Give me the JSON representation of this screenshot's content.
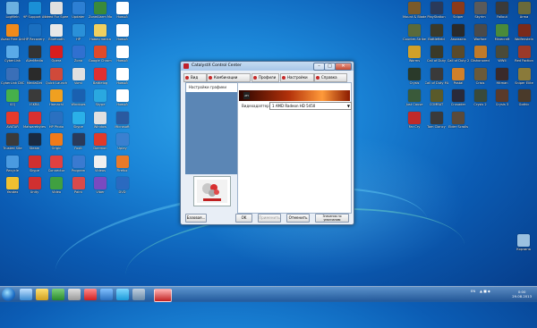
{
  "window": {
    "title": "CatalystX Control Center",
    "menus": [
      "Вид",
      "Комбинации клавиш",
      "Профили",
      "Настройки",
      "Справка"
    ],
    "left_tab": "Настройки графики",
    "right_label": "Видеоадаптер:",
    "adapter_value": "1 AMD Radeon HD 5450",
    "banner_badge": "ATI",
    "thumb_caption": "CATALYST",
    "buttons": {
      "basic": "Базовая...",
      "ok": "OK",
      "apply": "Применить",
      "cancel": "Отменить",
      "defaults": "Значения по умолчанию"
    },
    "controls": {
      "min": "–",
      "max": "□",
      "close": "✕"
    }
  },
  "desktop": {
    "left_icons": [
      {
        "label": "LogMeIn",
        "color": "#6bb0e0"
      },
      {
        "label": "HP Support Assistant",
        "color": "#1a8fd6"
      },
      {
        "label": "Need For Speed World",
        "color": "#e0e0e0"
      },
      {
        "label": "Updater",
        "color": "#2d7fd3"
      },
      {
        "label": "ZoneAlarm Mobile",
        "color": "#3a8a3a"
      },
      {
        "label": "Новый",
        "color": "#ffffff"
      },
      {
        "label": "Avast Free Antivirus",
        "color": "#f08a1a"
      },
      {
        "label": "HP Recovery",
        "color": "#1a6fc0"
      },
      {
        "label": "Bluetooth",
        "color": "#e8e8e8"
      },
      {
        "label": "HP",
        "color": "#2a90d8"
      },
      {
        "label": "Новая папка",
        "color": "#f0d060"
      },
      {
        "label": "Новый",
        "color": "#ffffff"
      },
      {
        "label": "CyberLink",
        "color": "#5aaae8"
      },
      {
        "label": "AVerMedia",
        "color": "#333333"
      },
      {
        "label": "Opera",
        "color": "#d81e1e"
      },
      {
        "label": "Zona",
        "color": "#3070d0"
      },
      {
        "label": "Google Chrome",
        "color": "#e04a2a"
      },
      {
        "label": "Новый",
        "color": "#ffffff"
      },
      {
        "label": "CyberLink DVD",
        "color": "#3a6fb8"
      },
      {
        "label": "MediaGet",
        "color": "#2a2a2a"
      },
      {
        "label": "Quick Launch",
        "color": "#d04a3a"
      },
      {
        "label": "Vomi",
        "color": "#e0e0e0"
      },
      {
        "label": "Battlelog",
        "color": "#e03030"
      },
      {
        "label": "Новый",
        "color": "#ffffff"
      },
      {
        "label": "ICQ",
        "color": "#46b04a"
      },
      {
        "label": "ISKRA",
        "color": "#3a3a3a"
      },
      {
        "label": "Hamachi",
        "color": "#f0a020"
      },
      {
        "label": "Windows",
        "color": "#1a60b0"
      },
      {
        "label": "Skype",
        "color": "#2aa8e0"
      },
      {
        "label": "Новый",
        "color": "#ffffff"
      },
      {
        "label": "AVATAR",
        "color": "#e83a2a"
      },
      {
        "label": "Malwarebytes",
        "color": "#d83030"
      },
      {
        "label": "HP Photo",
        "color": "#2a70c0"
      },
      {
        "label": "Skype",
        "color": "#2ab0e8"
      },
      {
        "label": "Window",
        "color": "#e0e0e0"
      },
      {
        "label": "Microsoft",
        "color": "#2a5aa0"
      },
      {
        "label": "Trusted Site",
        "color": "#3a3a3a"
      },
      {
        "label": "Steam",
        "color": "#1a2a40"
      },
      {
        "label": "Origin",
        "color": "#f07a1a"
      },
      {
        "label": "Foxit",
        "color": "#2a3a5a"
      },
      {
        "label": "Daemon",
        "color": "#e03a2a"
      },
      {
        "label": "Uplay",
        "color": "#3a80d0"
      },
      {
        "label": "Recycle",
        "color": "#4a9ae0"
      },
      {
        "label": "Skype",
        "color": "#d03030"
      },
      {
        "label": "Connector",
        "color": "#e04040"
      },
      {
        "label": "Program",
        "color": "#3a7ad0"
      },
      {
        "label": "Videos",
        "color": "#f0f0f0"
      },
      {
        "label": "Firefox",
        "color": "#e87a2a"
      },
      {
        "label": "Yandex",
        "color": "#f0c030"
      },
      {
        "label": "Unity",
        "color": "#d03030"
      },
      {
        "label": "Video",
        "color": "#40a040"
      },
      {
        "label": "Paint",
        "color": "#d84a4a"
      },
      {
        "label": "Viber",
        "color": "#7a4ac0"
      },
      {
        "label": "DVD",
        "color": "#2a6ac0"
      }
    ],
    "right_icons": [
      {
        "label": "Mount & Blade",
        "color": "#7a5a2a"
      },
      {
        "label": "PlayStation",
        "color": "#2a3a5a"
      },
      {
        "label": "Sniper",
        "color": "#8a3a1a"
      },
      {
        "label": "Skyrim",
        "color": "#5a5a5a"
      },
      {
        "label": "Fallout",
        "color": "#3a3a3a"
      },
      {
        "label": "Arma",
        "color": "#6a6a3a"
      },
      {
        "label": "Counter-Strike",
        "color": "#5a6a3a"
      },
      {
        "label": "Battlefield",
        "color": "#3a3a2a"
      },
      {
        "label": "Assassins",
        "color": "#2a2a2a"
      },
      {
        "label": "Warfare",
        "color": "#4a4a4a"
      },
      {
        "label": "Minecraft",
        "color": "#4a8a3a"
      },
      {
        "label": "Wolfenstein",
        "color": "#7a2a1a"
      },
      {
        "label": "Worms",
        "color": "#d0a02a"
      },
      {
        "label": "Call of Duty",
        "color": "#3a3a2a"
      },
      {
        "label": "Call of Duty 2",
        "color": "#5a4a2a"
      },
      {
        "label": "Dishonored",
        "color": "#c07a2a"
      },
      {
        "label": "WWII",
        "color": "#4a4a3a"
      },
      {
        "label": "Red Faction",
        "color": "#9a3a2a"
      },
      {
        "label": "Crysis",
        "color": "#2a3a2a"
      },
      {
        "label": "Call of Duty MW",
        "color": "#3a3a3a"
      },
      {
        "label": "Postal",
        "color": "#d0802a"
      },
      {
        "label": "Crisis",
        "color": "#6a5a3a"
      },
      {
        "label": "Hitman",
        "color": "#3a2a2a"
      },
      {
        "label": "Sniper Elite",
        "color": "#8a7a3a"
      },
      {
        "label": "Just Cause",
        "color": "#3a5a3a"
      },
      {
        "label": "COMBAT",
        "color": "#5a5a2a"
      },
      {
        "label": "Crusader",
        "color": "#2a2a3a"
      },
      {
        "label": "Crysis 2",
        "color": "#3a4a3a"
      },
      {
        "label": "Crysis 3",
        "color": "#5a3a2a"
      },
      {
        "label": "Gothic",
        "color": "#4a3a2a"
      },
      {
        "label": "Far Cry",
        "color": "#c02a2a"
      },
      {
        "label": "Tom Clancy",
        "color": "#3a3a3a"
      },
      {
        "label": "Elder Scrolls",
        "color": "#5a4a3a"
      },
      {
        "label": "Корзина",
        "color": "#9ac0e0"
      }
    ]
  },
  "taskbar": {
    "lang": "EN",
    "time": "0:00",
    "date": "29.08.2013"
  }
}
